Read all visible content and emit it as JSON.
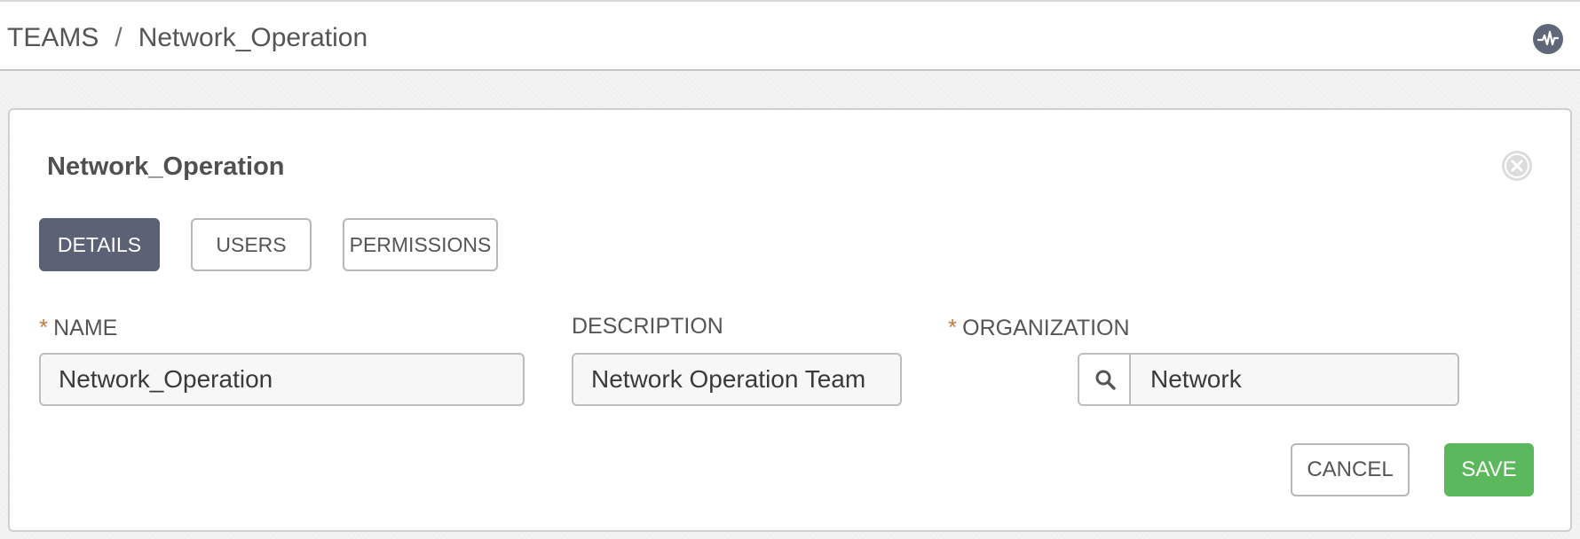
{
  "breadcrumb": {
    "parent": "TEAMS",
    "separator": "/",
    "current": "Network_Operation"
  },
  "header": {
    "activity_icon": "activity-stream-icon"
  },
  "panel": {
    "title": "Network_Operation",
    "close_icon": "close-circle-icon",
    "tabs": [
      {
        "label": "DETAILS",
        "active": true
      },
      {
        "label": "USERS",
        "active": false
      },
      {
        "label": "PERMISSIONS",
        "active": false
      }
    ]
  },
  "form": {
    "required_marker": "*",
    "name": {
      "label": "NAME",
      "value": "Network_Operation",
      "required": true
    },
    "description": {
      "label": "DESCRIPTION",
      "value": "Network Operation Team",
      "required": false
    },
    "organization": {
      "label": "ORGANIZATION",
      "value": "Network",
      "required": true,
      "lookup_icon": "search-icon"
    }
  },
  "actions": {
    "cancel_label": "CANCEL",
    "save_label": "SAVE"
  },
  "colors": {
    "active_tab": "#5b6275",
    "save_button": "#5cb85c",
    "required_marker": "#c47a3a",
    "activity_icon": "#5f6779"
  }
}
